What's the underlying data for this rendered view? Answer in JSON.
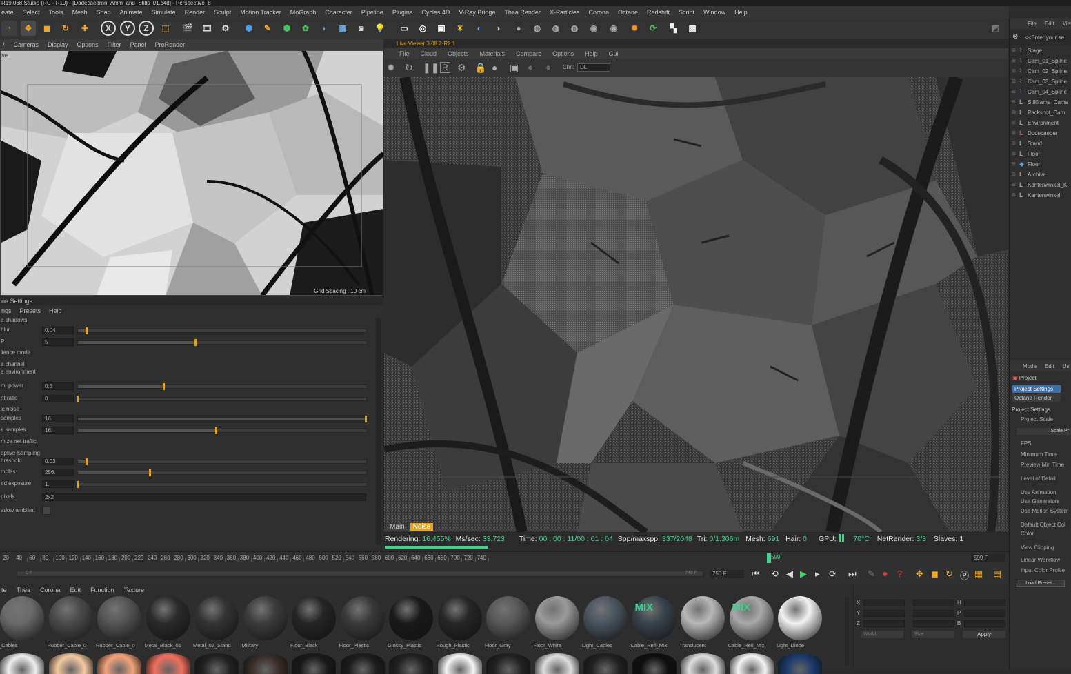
{
  "title": "R19.068 Studio (RC - R19) - [Dodecaedron_Anim_and_Stills_01.c4d] - Perspective_8",
  "menu": [
    "eate",
    "Select",
    "Tools",
    "Mesh",
    "Snap",
    "Animate",
    "Simulate",
    "Render",
    "Sculpt",
    "Motion Tracker",
    "MoGraph",
    "Character",
    "Pipeline",
    "Plugins",
    "Cycles 4D",
    "V-Ray Bridge",
    "Thea Render",
    "X-Particles",
    "Corona",
    "Octane",
    "Redshift",
    "Script",
    "Window",
    "Help"
  ],
  "viewport_left": {
    "menu": [
      "/",
      "Cameras",
      "Display",
      "Options",
      "Filter",
      "Panel",
      "ProRender"
    ],
    "view_label": "ive",
    "grid_spacing": "Grid Spacing : 10 cm"
  },
  "render_settings": {
    "title": "ne Settings",
    "menu": [
      "ngs",
      "Presets",
      "Help"
    ],
    "rows": [
      {
        "label": "a shadows",
        "value": null
      },
      {
        "label": "blur",
        "value": "0.04",
        "level": 0.03
      },
      {
        "label": "P",
        "value": "5",
        "level": 0.41
      },
      {
        "label": "liance mode",
        "value": null
      },
      {
        "label": "a channel",
        "value": null
      },
      {
        "label": "a environment",
        "value": null
      },
      {
        "label": "m. power",
        "value": "0.3",
        "level": 0.3
      },
      {
        "label": "nt ratio",
        "value": "0",
        "level": 0
      },
      {
        "label": "ic noise",
        "value": null
      },
      {
        "label": "samples",
        "value": "16.",
        "level": 1.0
      },
      {
        "label": "e samples",
        "value": "16.",
        "level": 0.48
      },
      {
        "label": "mize net traffic",
        "value": null
      },
      {
        "label": "aptive Sampling",
        "value": null
      },
      {
        "label": "hreshold",
        "value": "0.03",
        "level": 0.03
      },
      {
        "label": "mples",
        "value": "256.",
        "level": 0.25
      },
      {
        "label": "ed exposure",
        "value": "1.",
        "level": 0
      },
      {
        "label": "pixels",
        "value": "2x2",
        "level": null
      },
      {
        "label": "adow ambient",
        "value": null
      }
    ]
  },
  "live_viewer": {
    "title": "Live Viewer 3.08.2-R2.1",
    "menu": [
      "File",
      "Cloud",
      "Objects",
      "Materials",
      "Compare",
      "Options",
      "Help",
      "Gui"
    ],
    "channel_label": "Chn:",
    "channel_value": "DL",
    "tabs": [
      "Main",
      "Noise"
    ],
    "status": {
      "rendering_label": "Rendering:",
      "rendering_value": "16.455%",
      "mssec_label": "Ms/sec:",
      "mssec_value": "33.723",
      "time_label": "Time:",
      "time_value": "00 : 00 : 11/00 : 01 : 04",
      "spp_label": "Spp/maxspp:",
      "spp_value": "337/2048",
      "tri_label": "Tri:",
      "tri_value": "0/1.306m",
      "mesh_label": "Mesh:",
      "mesh_value": "691",
      "hair_label": "Hair:",
      "hair_value": "0",
      "gpu_label": "GPU:",
      "temp_value": "70°C",
      "netrender_label": "NetRender:",
      "netrender_value": "3/3",
      "slaves_label": "Slaves:",
      "slaves_value": "1",
      "progress": 0.16455
    }
  },
  "object_manager": {
    "menu": [
      "File",
      "Edit",
      "View"
    ],
    "search_placeholder": "<<Enter your se",
    "items": [
      "Stage",
      "Cam_01_Spline",
      "Cam_02_Spline",
      "Cam_03_Spline",
      "Cam_04_Spline",
      "Stillframe_Cams",
      "Packshot_Cam",
      "Environment",
      "Dodecaeder",
      "Stand",
      "Floor",
      "Floor",
      "Archive",
      "Kantenwinkel_K",
      "Kantenwinkel"
    ]
  },
  "attributes": {
    "menu": [
      "Mode",
      "Edit",
      "Us"
    ],
    "project_label": "Project",
    "tab_active": "Project Settings",
    "tab_2": "Octane Render",
    "section": "Project Settings",
    "fields": [
      "Project Scale",
      "FPS",
      "Minimum Time",
      "Preview Min Time",
      "Level of Detail",
      "Use Animation",
      "Use Generators",
      "Use Motion System",
      "Default Object Col",
      "Color",
      "View Clipping",
      "Linear Workflow",
      "Input Color Profile"
    ],
    "scale_button": "Scale Pr",
    "load_preset": "Load Preset..."
  },
  "timeline": {
    "ticks": [
      "20",
      "40",
      "60",
      "80",
      "100",
      "120",
      "140",
      "160",
      "180",
      "200",
      "220",
      "240",
      "260",
      "280",
      "300",
      "320",
      "340",
      "360",
      "380",
      "400",
      "420",
      "440",
      "460",
      "480",
      "500",
      "520",
      "540",
      "560",
      "580",
      "600",
      "620",
      "640",
      "660",
      "680",
      "700",
      "720",
      "740"
    ],
    "current_frame": "599",
    "end_frame_readout": "599 F",
    "range_start": "0 F",
    "range_end": "749 F",
    "max_frame": "750 F"
  },
  "material_manager": {
    "menu": [
      "te",
      "Thea",
      "Corona",
      "Edit",
      "Function",
      "Texture"
    ],
    "materials": [
      {
        "name": "_Cables",
        "color": "#6a6a6a",
        "mix": false
      },
      {
        "name": "Rubber_Cable_0",
        "color": "#4a4a4a",
        "mix": false
      },
      {
        "name": "Rubber_Cable_0",
        "color": "#555",
        "mix": false
      },
      {
        "name": "Metal_Black_01",
        "color": "#2a2a2a",
        "mix": false
      },
      {
        "name": "Metal_02_Stand",
        "color": "#333",
        "mix": false
      },
      {
        "name": "Military",
        "color": "#3c3c3c",
        "mix": false
      },
      {
        "name": "Floor_Black",
        "color": "#252525",
        "mix": false
      },
      {
        "name": "Floor_Plastic",
        "color": "#3a3a3a",
        "mix": false
      },
      {
        "name": "Glossy_Plastic",
        "color": "#1a1a1a",
        "mix": false
      },
      {
        "name": "Rough_Plastic",
        "color": "#262626",
        "mix": false
      },
      {
        "name": "Floor_Gray",
        "color": "#585858",
        "mix": false
      },
      {
        "name": "Floor_White",
        "color": "#9a9a9a",
        "mix": false
      },
      {
        "name": "Light_Cables",
        "color": "#4a5460",
        "mix": false
      },
      {
        "name": "Cable_Refl_Mix",
        "color": "#39434d",
        "mix": true
      },
      {
        "name": "Translucent",
        "color": "#b8b8b8",
        "mix": false
      },
      {
        "name": "Cable_Refl_Mix",
        "color": "#a8a8a8",
        "mix": true
      },
      {
        "name": "Light_Diode",
        "color": "#f2f2f2",
        "mix": false
      }
    ],
    "mix_label": "MIX"
  },
  "coords": {
    "world": "World",
    "size": "Size",
    "apply": "Apply",
    "labels": [
      "X",
      "Y",
      "Z",
      "H",
      "P",
      "B"
    ]
  }
}
